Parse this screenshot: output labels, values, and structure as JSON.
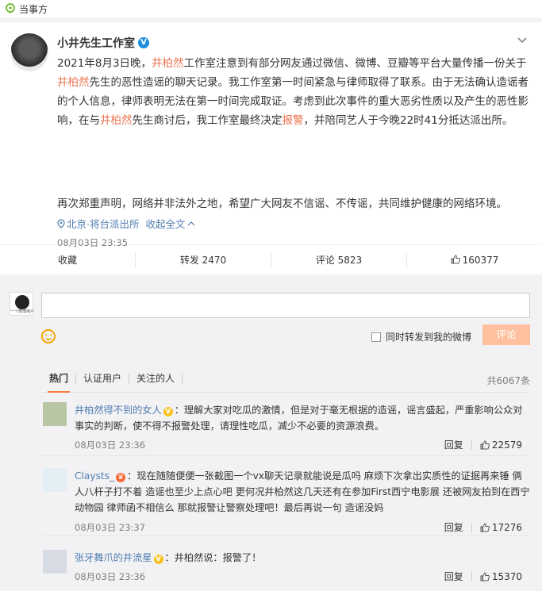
{
  "topbar": {
    "label": "当事方",
    "icon": "location-pin-icon"
  },
  "post": {
    "author": "小井先生工作室",
    "verified_badge": "V",
    "text_parts": [
      "2021年8月3日晚，",
      "井柏然",
      "工作室注意到有部分网友通过微信、微博、豆瓣等平台大量传播一份关于",
      "井柏然",
      "先生的恶性造谣的聊天记录。我工作室第一时间紧急与律师取得了联系。由于无法确认造谣者的个人信息，律师表明无法在第一时间完成取证。考虑到此次事件的重大恶劣性质以及产生的恶性影响，在与",
      "井柏然",
      "先生商讨后，我工作室最终决定",
      "报警",
      "，并陪同艺人于今晚22时41分抵达派出所。"
    ],
    "para2": "再次郑重声明，网络并非法外之地，希望广大网友不信谣、不传谣，共同维护健康的网络环境。",
    "location": "北京·将台派出所",
    "collapse": "收起全文",
    "time": "08月03日 23:35"
  },
  "actions": {
    "favorite": "收藏",
    "repost": "转发 2470",
    "comment": "评论 5823",
    "like": "160377"
  },
  "compose": {
    "avatar_caption": "一个微博用户",
    "placeholder": "",
    "forward_label": "同时转发到我的微博",
    "submit": "评论"
  },
  "comment_tabs": {
    "tabs": [
      "热门",
      "认证用户",
      "关注的人"
    ],
    "total": "共6067条"
  },
  "comments": [
    {
      "user": "井柏然得不到的女人",
      "badge": "V",
      "text": "：理解大家对吃瓜的激情，但是对于毫无根据的造谣，谣言盛起，严重影响公众对事实的判断，使不得不报警处理，请理性吃瓜，减少不必要的资源浪费。",
      "time": "08月03日 23:36",
      "reply": "回复",
      "likes": "22579"
    },
    {
      "user": "Claysts_",
      "badge": "♛",
      "text": "：现在随随便便一张截图一个vx聊天记录就能说是瓜吗 麻烦下次拿出实质性的证据再来锤 俩人八杆子打不着 造谣也至少上点心吧 更何况井柏然这几天还有在参加First西宁电影展 还被网友拍到在西宁动物园 律师函不相信么 那就报警让警察处理吧！最后再说一句 造谣没妈",
      "time": "08月03日 23:37",
      "reply": "回复",
      "likes": "17276"
    },
    {
      "user": "张牙舞爪的井流星",
      "badge": "V",
      "text": "：井柏然说：报警了！",
      "time": "08月03日 23:36",
      "reply": "回复",
      "likes": "15370"
    }
  ]
}
